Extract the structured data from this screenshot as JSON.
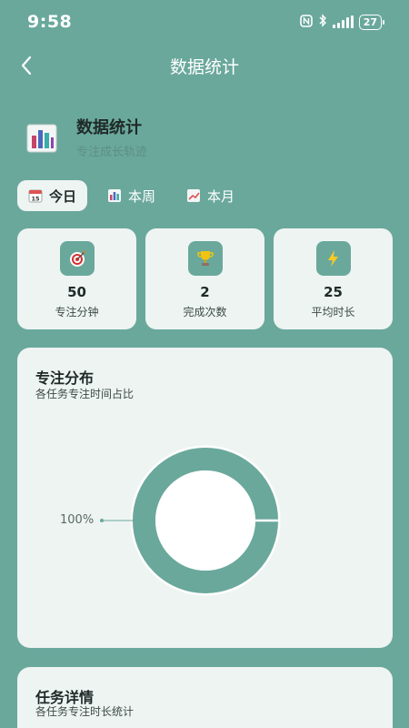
{
  "status_bar": {
    "time": "9:58",
    "battery": "27"
  },
  "nav": {
    "title": "数据统计"
  },
  "header": {
    "title": "数据统计",
    "subtitle": "专注成长轨迹"
  },
  "tabs": [
    {
      "label": "今日",
      "icon": "calendar-icon",
      "active": true
    },
    {
      "label": "本周",
      "icon": "bar-chart-icon",
      "active": false
    },
    {
      "label": "本月",
      "icon": "trend-icon",
      "active": false
    }
  ],
  "stats": [
    {
      "value": "50",
      "label": "专注分钟",
      "icon": "target-icon"
    },
    {
      "value": "2",
      "label": "完成次数",
      "icon": "trophy-icon"
    },
    {
      "value": "25",
      "label": "平均时长",
      "icon": "lightning-icon"
    }
  ],
  "distribution": {
    "title": "专注分布",
    "subtitle": "各任务专注时间占比",
    "chart_data": {
      "type": "pie",
      "values": [
        100
      ],
      "labels": [
        "100%"
      ],
      "colors": [
        "#6aa89c"
      ]
    }
  },
  "detail": {
    "title": "任务详情",
    "subtitle": "各任务专注时长统计"
  },
  "colors": {
    "background": "#6aa89c",
    "card": "#eef4f2",
    "accent": "#6aa89c"
  }
}
